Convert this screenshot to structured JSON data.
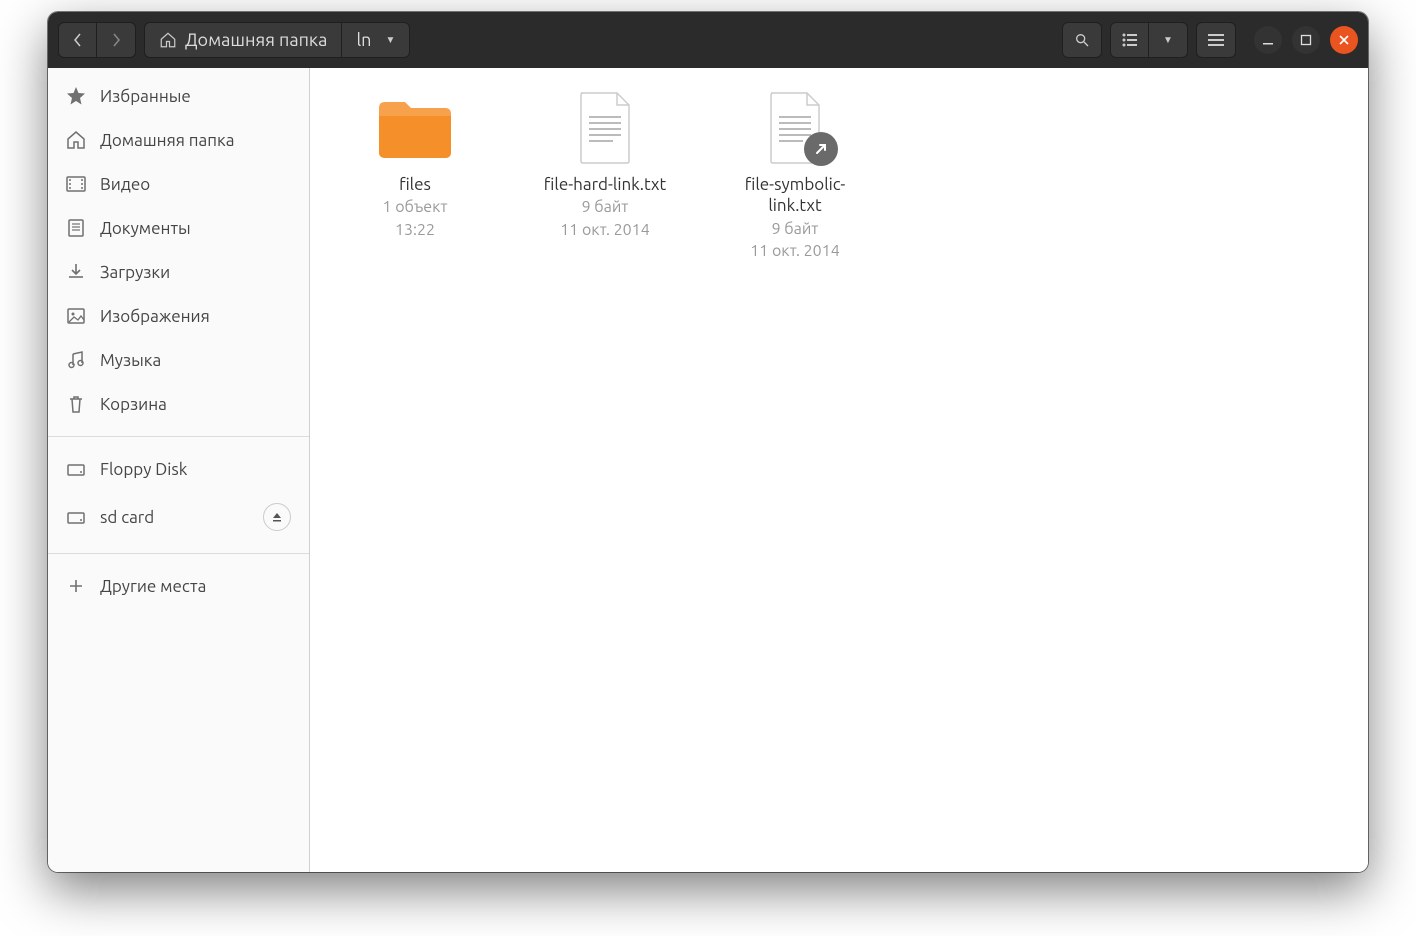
{
  "path": {
    "home_label": "Домашняя папка",
    "current": "ln"
  },
  "sidebar": {
    "items_main": [
      {
        "id": "starred",
        "label": "Избранные",
        "icon": "star"
      },
      {
        "id": "home",
        "label": "Домашняя папка",
        "icon": "home"
      },
      {
        "id": "videos",
        "label": "Видео",
        "icon": "video"
      },
      {
        "id": "documents",
        "label": "Документы",
        "icon": "document"
      },
      {
        "id": "downloads",
        "label": "Загрузки",
        "icon": "download"
      },
      {
        "id": "pictures",
        "label": "Изображения",
        "icon": "picture"
      },
      {
        "id": "music",
        "label": "Музыка",
        "icon": "music"
      },
      {
        "id": "trash",
        "label": "Корзина",
        "icon": "trash"
      }
    ],
    "items_devices": [
      {
        "id": "floppy",
        "label": "Floppy Disk",
        "icon": "drive"
      },
      {
        "id": "sdcard",
        "label": "sd card",
        "icon": "drive",
        "eject": true
      }
    ],
    "other_places": "Другие места"
  },
  "files": [
    {
      "name": "files",
      "type": "folder",
      "meta1": "1 объект",
      "meta2": "13:22"
    },
    {
      "name": "file-hard-link.txt",
      "type": "text",
      "meta1": "9 байт",
      "meta2": "11 окт. 2014"
    },
    {
      "name": "file-symbolic-link.txt",
      "type": "text-symlink",
      "meta1": "9 байт",
      "meta2": "11 окт. 2014"
    }
  ]
}
